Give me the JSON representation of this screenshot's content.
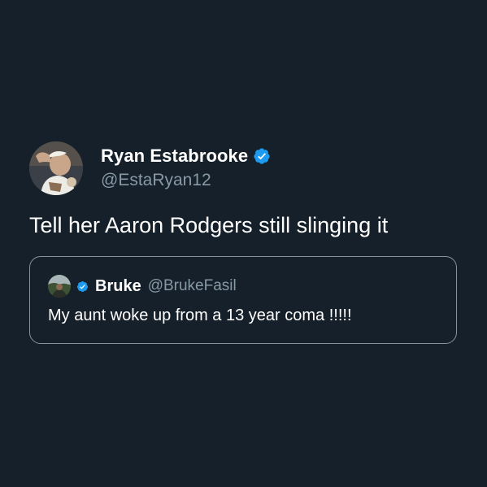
{
  "colors": {
    "background": "#16202a",
    "text_primary": "#ffffff",
    "text_secondary": "#8899a6",
    "verified_blue": "#1d9bf0",
    "quote_border": "#8a939c"
  },
  "tweet": {
    "author": {
      "display_name": "Ryan Estabrooke",
      "handle": "@EstaRyan12",
      "verified": true,
      "avatar_icon": "profile-photo"
    },
    "text": "Tell her Aaron Rodgers still slinging it",
    "quoted_tweet": {
      "author": {
        "display_name": "Bruke",
        "handle": "@BrukeFasil",
        "verified": true,
        "avatar_icon": "profile-photo"
      },
      "text": "My aunt woke up from a 13 year coma !!!!!"
    }
  }
}
